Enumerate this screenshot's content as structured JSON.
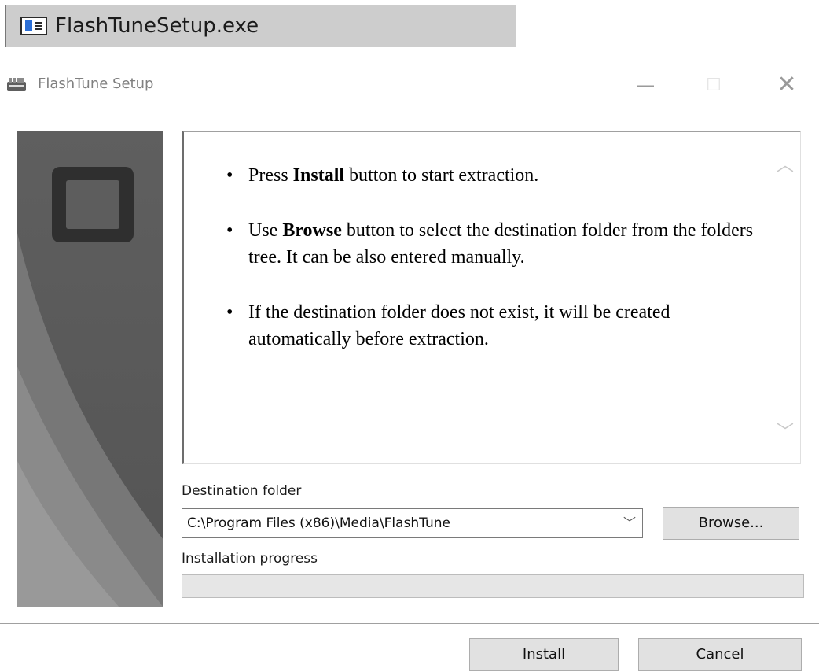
{
  "file_bar": {
    "filename": "FlashTuneSetup.exe",
    "icon": "window-app-icon"
  },
  "window": {
    "title": "FlashTune Setup",
    "icon": "installer-app-icon",
    "controls": [
      "minimize",
      "maximize",
      "close"
    ]
  },
  "info": {
    "items": [
      {
        "pre": "Press ",
        "bold": "Install",
        "post": " button to start extraction."
      },
      {
        "pre": "Use ",
        "bold": "Browse",
        "post": " button to select the destination folder from the folders tree. It can be also entered manually."
      },
      {
        "pre": "",
        "bold": "",
        "post": "If the destination folder does not exist, it will be created automatically before extraction."
      }
    ]
  },
  "destination": {
    "label": "Destination folder",
    "value": "C:\\Program Files (x86)\\Media\\FlashTune",
    "browse_label": "Browse..."
  },
  "progress": {
    "label": "Installation progress",
    "value_percent": 0,
    "fill_color": "#06b025"
  },
  "footer": {
    "install_label": "Install",
    "cancel_label": "Cancel"
  }
}
